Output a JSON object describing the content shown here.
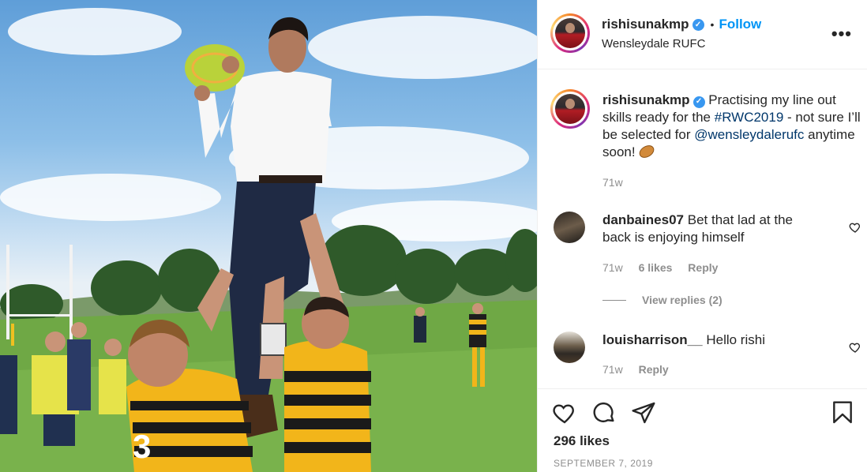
{
  "header": {
    "username": "rishisunakmp",
    "verified_mark": "✓",
    "separator": "•",
    "follow_label": "Follow",
    "location": "Wensleydale RUFC",
    "more_label": "•••"
  },
  "caption": {
    "username": "rishisunakmp",
    "text_part1": "Practising my line out skills ready for the",
    "hashtag": "#RWC2019",
    "text_part2": "- not sure I’ll be selected for",
    "mention": "@wensleydalerufc",
    "text_part3": "anytime soon!",
    "emoji": "rugby-ball",
    "time": "71w"
  },
  "comments": [
    {
      "username": "danbaines07",
      "text": "Bet that lad at the back is enjoying himself",
      "time": "71w",
      "likes": "6 likes",
      "reply_label": "Reply"
    },
    {
      "username": "louisharrison__",
      "text": "Hello rishi",
      "time": "71w",
      "reply_label": "Reply"
    }
  ],
  "view_replies_label": "View replies (2)",
  "actions": {
    "icons": [
      "heart-icon",
      "comment-icon",
      "share-icon",
      "bookmark-icon"
    ],
    "likes": "296 likes",
    "date": "SEPTEMBER 7, 2019"
  },
  "colors": {
    "accent": "#0095f6",
    "link": "#00376b",
    "muted": "#8e8e8e",
    "text": "#262626",
    "verified": "#3897f0"
  }
}
